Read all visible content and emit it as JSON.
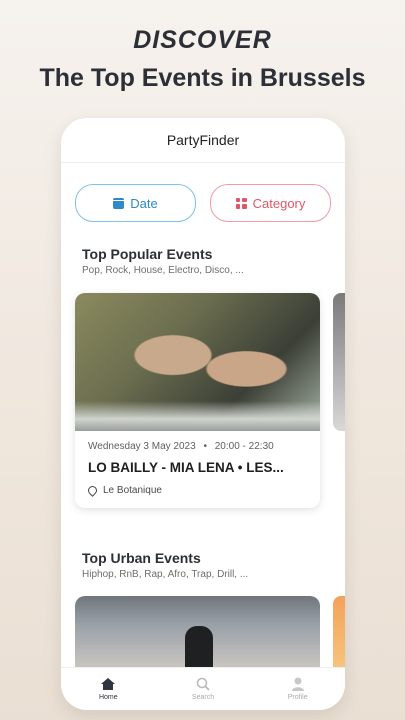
{
  "headline": {
    "line1": "DISCOVER",
    "line2": "The Top Events in Brussels"
  },
  "app": {
    "title": "PartyFinder"
  },
  "filters": {
    "date_label": "Date",
    "category_label": "Category"
  },
  "sections": [
    {
      "title": "Top Popular Events",
      "subtitle": "Pop, Rock, House, Electro, Disco, ...",
      "card": {
        "date": "Wednesday 3 May 2023",
        "separator": "•",
        "time": "20:00 - 22:30",
        "title": "LO BAILLY - MIA LENA • LES...",
        "venue": "Le Botanique"
      }
    },
    {
      "title": "Top Urban Events",
      "subtitle": "Hiphop, RnB, Rap, Afro, Trap, Drill, ..."
    }
  ],
  "nav": {
    "items": [
      {
        "label": "Home",
        "icon": "home-icon",
        "active": true
      },
      {
        "label": "Search",
        "icon": "search-icon",
        "active": false
      },
      {
        "label": "Profile",
        "icon": "profile-icon",
        "active": false
      }
    ]
  },
  "colors": {
    "date_accent": "#2f88c8",
    "category_accent": "#e05667"
  }
}
